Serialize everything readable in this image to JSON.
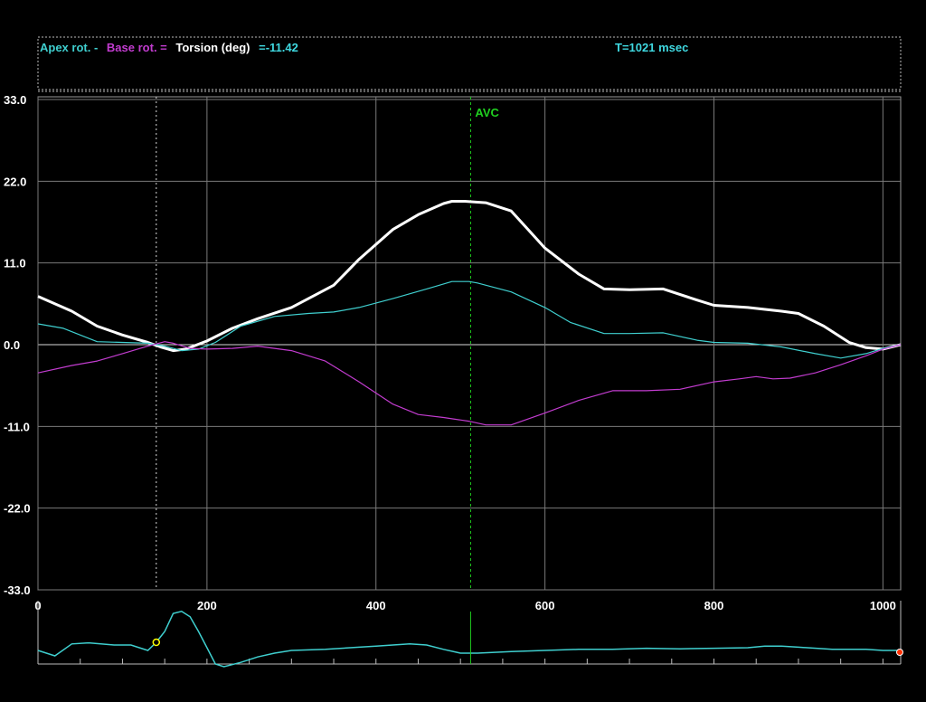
{
  "header": {
    "apex_label": "Apex rot. -",
    "base_label": "Base rot. =",
    "torsion_label": "Torsion (deg)",
    "current_value": "=-11.42",
    "time_readout": "T=1021 msec"
  },
  "colors": {
    "apex": "#3fcfcf",
    "base": "#c23ccf",
    "torsion": "#ffffff",
    "readout": "#3fd8e0",
    "avc": "#20d020",
    "grid": "#7a7a7a",
    "ecg": "#3fcfcf"
  },
  "chart_data": {
    "type": "line",
    "xlim": [
      0,
      1021
    ],
    "ylim": [
      -33,
      33
    ],
    "x_ticks": [
      "0",
      "200",
      "400",
      "600",
      "800",
      "1000"
    ],
    "y_ticks": [
      "33.0",
      "22.0",
      "11.0",
      "0.0",
      "-11.0",
      "-22.0",
      "-33.0"
    ],
    "markers": {
      "avc_label": "AVC",
      "avc_time": 512,
      "cursor_time": 140
    },
    "series": [
      {
        "key": "torsion",
        "x": [
          0,
          40,
          70,
          100,
          130,
          145,
          160,
          175,
          200,
          230,
          260,
          300,
          330,
          350,
          380,
          420,
          450,
          480,
          490,
          505,
          530,
          560,
          600,
          640,
          670,
          700,
          740,
          780,
          800,
          840,
          880,
          900,
          930,
          960,
          980,
          1000,
          1021
        ],
        "y": [
          6.5,
          4.5,
          2.5,
          1.3,
          0.3,
          -0.3,
          -0.8,
          -0.6,
          0.5,
          2.2,
          3.5,
          5,
          6.8,
          8,
          11.5,
          15.5,
          17.5,
          19,
          19.3,
          19.3,
          19.1,
          18,
          13,
          9.5,
          7.5,
          7.4,
          7.5,
          6,
          5.3,
          5,
          4.5,
          4.2,
          2.5,
          0.3,
          -0.4,
          -0.6,
          0
        ]
      },
      {
        "key": "apex",
        "x": [
          0,
          30,
          70,
          100,
          130,
          150,
          170,
          190,
          210,
          240,
          280,
          320,
          350,
          380,
          420,
          460,
          490,
          510,
          520,
          560,
          600,
          630,
          670,
          700,
          740,
          780,
          800,
          840,
          880,
          920,
          950,
          980,
          1000,
          1021
        ],
        "y": [
          2.8,
          2.2,
          0.4,
          0.3,
          0.2,
          -0.2,
          -0.8,
          -0.6,
          0.3,
          2.5,
          3.8,
          4.2,
          4.4,
          5,
          6.2,
          7.5,
          8.5,
          8.5,
          8.3,
          7.1,
          5,
          3,
          1.5,
          1.5,
          1.6,
          0.6,
          0.3,
          0.2,
          -0.3,
          -1.2,
          -1.8,
          -1.2,
          -0.5,
          0
        ]
      },
      {
        "key": "base",
        "x": [
          0,
          40,
          70,
          100,
          130,
          150,
          160,
          180,
          200,
          230,
          260,
          300,
          340,
          380,
          420,
          450,
          480,
          510,
          530,
          560,
          600,
          640,
          680,
          720,
          760,
          800,
          830,
          850,
          870,
          890,
          920,
          950,
          980,
          1000,
          1021
        ],
        "y": [
          -3.8,
          -2.8,
          -2.2,
          -1.2,
          -0.2,
          0.4,
          0.2,
          -0.5,
          -0.6,
          -0.5,
          -0.2,
          -0.8,
          -2.2,
          -5,
          -8,
          -9.4,
          -9.8,
          -10.3,
          -10.8,
          -10.8,
          -9.2,
          -7.5,
          -6.2,
          -6.2,
          -6,
          -5,
          -4.6,
          -4.3,
          -4.6,
          -4.5,
          -3.8,
          -2.7,
          -1.5,
          -0.6,
          0
        ]
      }
    ]
  },
  "ecg": {
    "x": [
      0,
      20,
      40,
      60,
      90,
      110,
      120,
      130,
      140,
      150,
      160,
      170,
      180,
      190,
      200,
      210,
      220,
      240,
      260,
      280,
      300,
      340,
      380,
      400,
      420,
      440,
      460,
      480,
      500,
      520,
      560,
      600,
      640,
      680,
      720,
      760,
      800,
      840,
      860,
      880,
      900,
      940,
      980,
      1000,
      1021
    ],
    "y": [
      0,
      -0.1,
      0.12,
      0.14,
      0.1,
      0.1,
      0.05,
      0,
      0.15,
      0.35,
      0.68,
      0.72,
      0.62,
      0.35,
      0.05,
      -0.25,
      -0.3,
      -0.22,
      -0.12,
      -0.05,
      0,
      0.02,
      0.06,
      0.08,
      0.1,
      0.12,
      0.1,
      0.02,
      -0.05,
      -0.05,
      -0.02,
      0,
      0.02,
      0.02,
      0.04,
      0.03,
      0.04,
      0.05,
      0.08,
      0.08,
      0.06,
      0.02,
      0.02,
      0,
      0
    ],
    "start_marker_time": 140,
    "end_marker_time": 1021
  }
}
